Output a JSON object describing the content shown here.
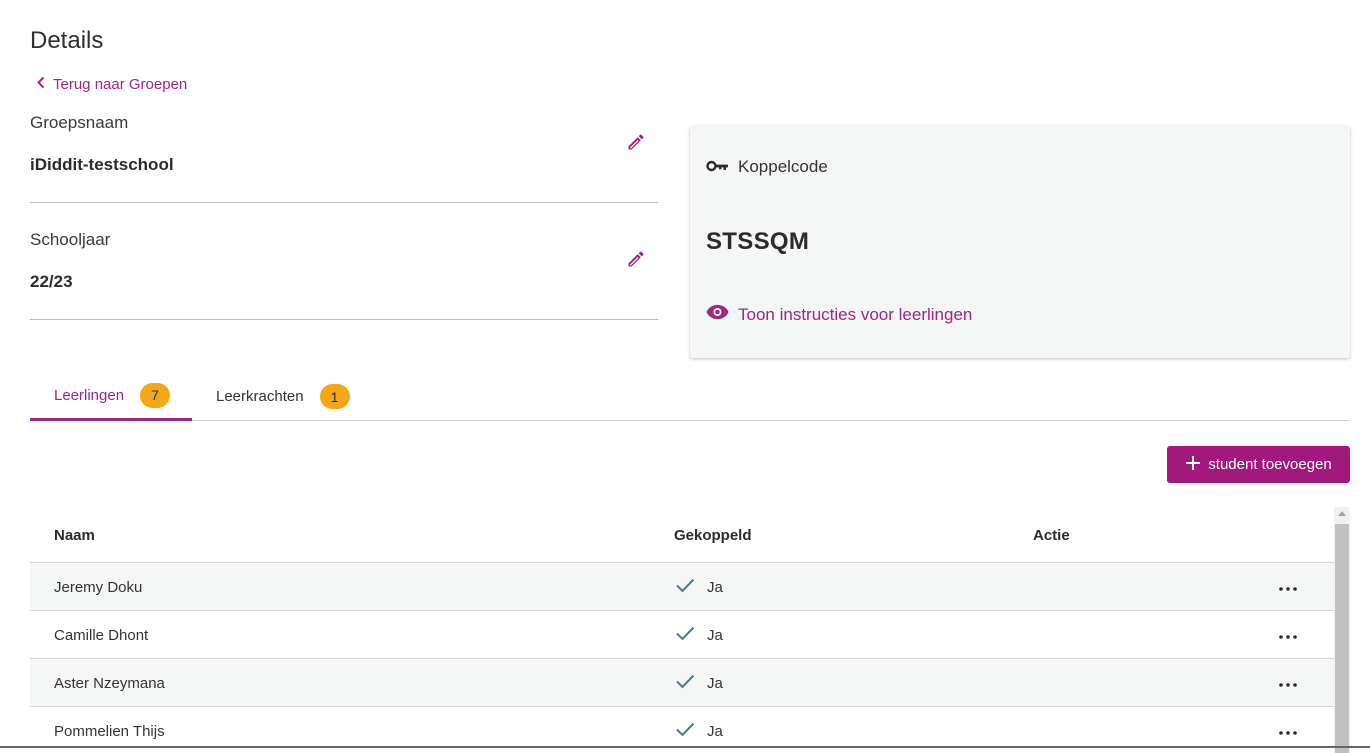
{
  "page": {
    "title": "Details"
  },
  "back_link": {
    "label": "Terug naar Groepen"
  },
  "group": {
    "name_label": "Groepsnaam",
    "name_value": "iDiddit-testschool",
    "year_label": "Schooljaar",
    "year_value": "22/23"
  },
  "code_card": {
    "label": "Koppelcode",
    "code": "STSSQM",
    "instructions_link": "Toon instructies voor leerlingen"
  },
  "tabs": [
    {
      "label": "Leerlingen",
      "count": "7",
      "active": true
    },
    {
      "label": "Leerkrachten",
      "count": "1",
      "active": false
    }
  ],
  "actions": {
    "add_student_label": "student toevoegen"
  },
  "table": {
    "headers": {
      "name": "Naam",
      "linked": "Gekoppeld",
      "action": "Actie"
    },
    "rows": [
      {
        "name": "Jeremy Doku",
        "linked": "Ja"
      },
      {
        "name": "Camille Dhont",
        "linked": "Ja"
      },
      {
        "name": "Aster Nzeymana",
        "linked": "Ja"
      },
      {
        "name": "Pommelien Thijs",
        "linked": "Ja"
      }
    ]
  },
  "icons": {
    "back": "chevron-left-icon",
    "edit": "pencil-icon",
    "key": "key-icon",
    "eye": "eye-icon",
    "add": "plus-icon",
    "check": "check-icon",
    "more": "more-horizontal-icon"
  },
  "colors": {
    "accent": "#a3257e",
    "button": "#a3187d",
    "badge": "#f3a712",
    "check": "#4a7a86",
    "card_bg": "#f5f6f6"
  }
}
